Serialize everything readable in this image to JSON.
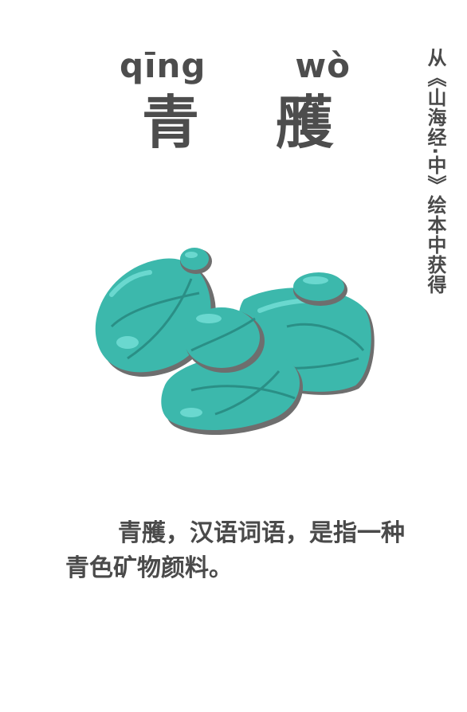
{
  "pinyin": {
    "syllable_1": "qīng",
    "syllable_2": "wò"
  },
  "title": {
    "char_1": "青",
    "char_2": "雘"
  },
  "side_note": "从《山海经·中》绘本中获得",
  "description": "青雘，汉语词语，是指一种青色矿物颜料。",
  "illustration": {
    "icon": "teal-stones-illustration",
    "colors": {
      "stone_main": "#3cb8ac",
      "stone_highlight": "#6ad8cf",
      "stone_dark": "#2a8f86",
      "shadow": "#6e6e6e"
    }
  }
}
